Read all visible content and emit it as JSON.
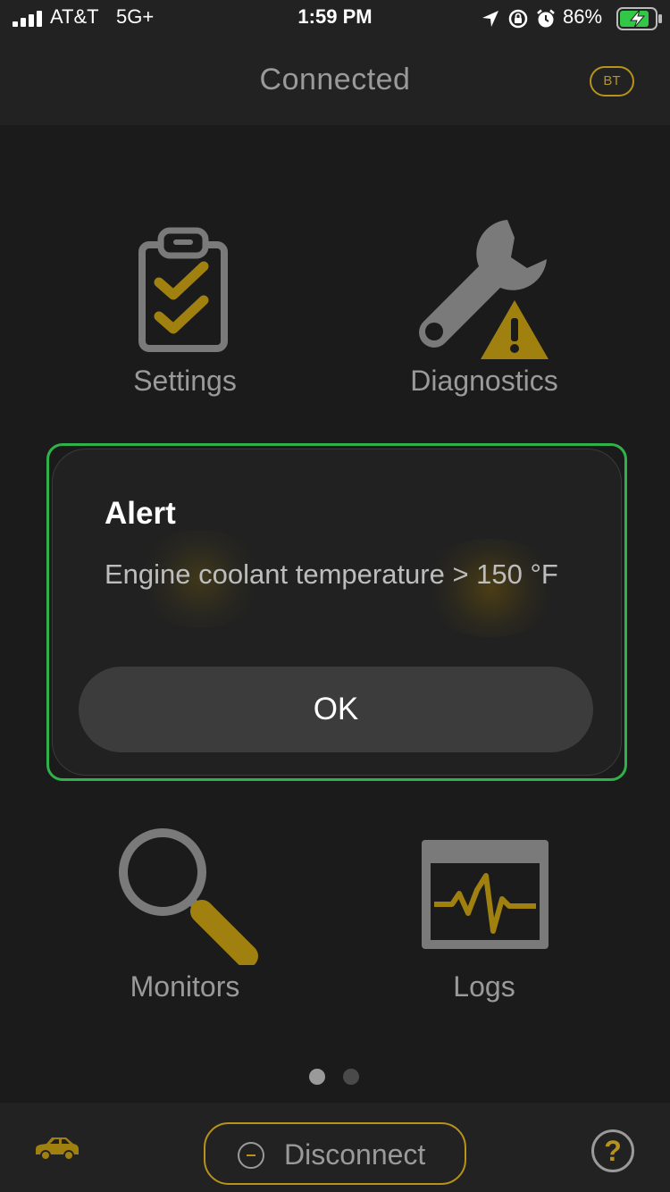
{
  "status": {
    "carrier": "AT&T",
    "network": "5G+",
    "time": "1:59 PM",
    "battery": "86%"
  },
  "nav": {
    "title": "Connected",
    "bt_badge": "BT"
  },
  "tiles": [
    {
      "label": "Settings",
      "icon": "clipboard-check-icon"
    },
    {
      "label": "Diagnostics",
      "icon": "wrench-warning-icon"
    },
    {
      "label": "Monitors",
      "icon": "magnifier-icon"
    },
    {
      "label": "Logs",
      "icon": "waveform-monitor-icon"
    }
  ],
  "alert": {
    "title": "Alert",
    "message": "Engine coolant temperature > 150 °F",
    "ok_label": "OK"
  },
  "pager": {
    "pages": 2,
    "active": 0
  },
  "tabbar": {
    "disconnect_label": "Disconnect",
    "help_label": "?"
  },
  "colors": {
    "accent": "#b8921a",
    "gray": "#7a7a7a",
    "alert_outline": "#2fb24a"
  }
}
